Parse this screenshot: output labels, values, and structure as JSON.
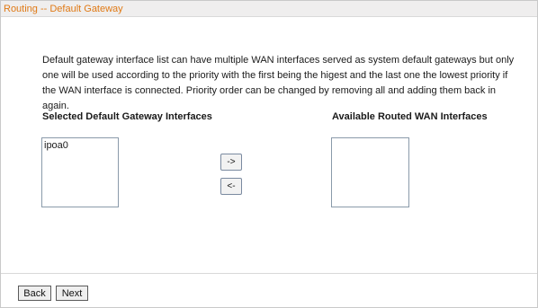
{
  "page": {
    "title": "Routing -- Default Gateway",
    "description": "Default gateway interface list can have multiple WAN interfaces served as system default gateways but only one will be used according to the priority with the first being the higest and the last one the lowest priority if the WAN interface is connected. Priority order can be changed by removing all and adding them back in again."
  },
  "selected": {
    "header": "Selected Default Gateway Interfaces",
    "items": [
      "ipoa0"
    ]
  },
  "available": {
    "header": "Available Routed WAN Interfaces",
    "items": []
  },
  "move_buttons": {
    "add_label": "->",
    "remove_label": "<-"
  },
  "nav": {
    "back_label": "Back",
    "next_label": "Next"
  },
  "colors": {
    "title_text": "#e07a16",
    "title_bar_bg": "#efeeee"
  }
}
